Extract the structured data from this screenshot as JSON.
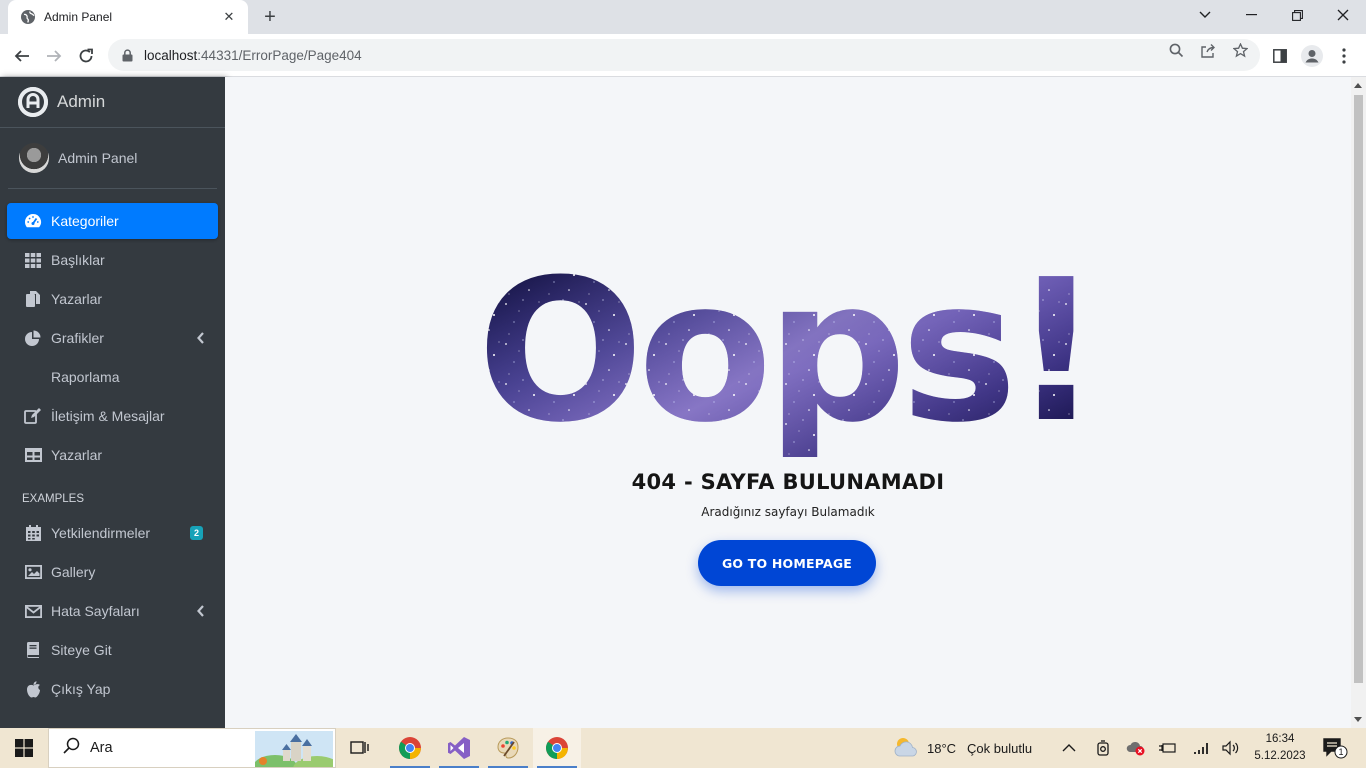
{
  "browser": {
    "tab_title": "Admin Panel",
    "url_host": "localhost",
    "url_path": ":44331/ErrorPage/Page404"
  },
  "sidebar": {
    "brand": "Admin",
    "user_name": "Admin Panel",
    "items": [
      {
        "label": "Kategoriler",
        "icon": "tachometer-icon",
        "active": true
      },
      {
        "label": "Başlıklar",
        "icon": "grid-icon"
      },
      {
        "label": "Yazarlar",
        "icon": "copy-icon"
      },
      {
        "label": "Grafikler",
        "icon": "pie-chart-icon",
        "has_chevron": true
      },
      {
        "label": "Raporlama"
      },
      {
        "label": "İletişim & Mesajlar",
        "icon": "edit-icon"
      },
      {
        "label": "Yazarlar",
        "icon": "table-icon"
      }
    ],
    "section_header": "EXAMPLES",
    "example_items": [
      {
        "label": "Yetkilendirmeler",
        "icon": "calendar-icon",
        "badge": "2"
      },
      {
        "label": "Gallery",
        "icon": "image-icon"
      },
      {
        "label": "Hata Sayfaları",
        "icon": "envelope-icon",
        "has_chevron": true
      },
      {
        "label": "Siteye Git",
        "icon": "book-icon"
      },
      {
        "label": "Çıkış Yap",
        "icon": "apple-icon"
      }
    ]
  },
  "error_page": {
    "headline": "Oops!",
    "title": "404 - SAYFA BULUNAMADI",
    "subtitle": "Aradığınız sayfayı Bulamadık",
    "button_label": "GO TO HOMEPAGE"
  },
  "taskbar": {
    "search_placeholder": "Ara",
    "weather_temp": "18°C",
    "weather_desc": "Çok bulutlu",
    "time": "16:34",
    "date": "5.12.2023",
    "notification_count": "1"
  },
  "colors": {
    "sidebar_bg": "#343a40",
    "active_item": "#007bff",
    "badge": "#17a2b8",
    "button": "#0046d5",
    "content_bg": "#f4f6f9"
  }
}
